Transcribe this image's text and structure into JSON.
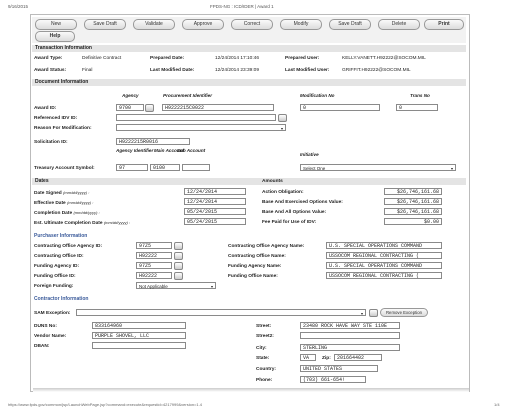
{
  "header": {
    "date": "9/16/2015",
    "title": "FPDS-NG : ICD/IDER | Award 1"
  },
  "toolbar": {
    "buttons": [
      "New",
      "Save Draft",
      "Validate",
      "Approve",
      "Correct",
      "Modify",
      "Save Draft",
      "Delete",
      "Print",
      "Help"
    ]
  },
  "transaction": {
    "section": "Transaction Information",
    "award_type_label": "Award Type:",
    "award_type": "Definitive Contract",
    "prepared_date_label": "Prepared Date:",
    "prepared_date": "12/24/2014 17:10:46",
    "prepared_user_label": "Prepared User:",
    "prepared_user": "KELLY.VANETT.H92222@SOCOM.MIL",
    "award_status_label": "Award Status:",
    "award_status": "Final",
    "last_modified_date_label": "Last Modified Date:",
    "last_modified_date": "12/24/2014 23:39:09",
    "last_modified_user_label": "Last Modified User:",
    "last_modified_user": "GRIFFIT.H92222@SOCOM.MIL"
  },
  "document": {
    "section": "Document Information",
    "col_agency": "Agency",
    "col_proc": "Procurement Identifier",
    "col_mod": "Modification No",
    "col_trans": "Trans No",
    "award_id_label": "Award ID:",
    "agency_code": "9700",
    "proc_id": "H9222215C0022",
    "mod_no": "0",
    "trans_no": "0",
    "ref_idv_label": "Referenced IDV ID:",
    "reason_label": "Reason For Modification:",
    "solicitation_label": "Solicitation ID:",
    "solicitation_id": "H9222215R0016",
    "col_agency_id": "Agency Identifier",
    "col_main": "Main Account",
    "col_sub": "Sub Account",
    "col_initiative": "Initiative",
    "tas_label": "Treasury Account Symbol:",
    "tas_agency": "97",
    "tas_main": "0100",
    "initiative": "Select One"
  },
  "dates": {
    "section": "Dates",
    "signed_label": "Date Signed",
    "signed_fmt": "(mm/dd/yyyy) :",
    "signed": "12/24/2014",
    "effective_label": "Effective Date",
    "effective_fmt": "(mm/dd/yyyy) :",
    "effective": "12/24/2014",
    "completion_label": "Completion Date",
    "completion_fmt": "(mm/dd/yyyy) :",
    "completion": "05/24/2015",
    "est_label": "Est. Ultimate Completion Date",
    "est_fmt": "(mm/dd/yyyy) :",
    "est": "05/24/2015"
  },
  "amounts": {
    "section": "Amounts",
    "obligation_label": "Action Obligation:",
    "obligation": "$26,746,161.68",
    "exercised_label": "Base And Exercised Options Value:",
    "exercised": "$26,746,161.68",
    "all_options_label": "Base And All Options Value:",
    "all_options": "$26,746,161.68",
    "fee_label": "Fee Paid for Use of IDV:",
    "fee": "$0.00"
  },
  "purchaser": {
    "section": "Purchaser Information",
    "co_agency_id_label": "Contracting Office Agency ID:",
    "co_agency_id": "97Z5",
    "co_agency_name_label": "Contracting Office Agency Name:",
    "co_agency_name": "U.S. SPECIAL OPERATIONS COMMAND",
    "co_id_label": "Contracting Office ID:",
    "co_id": "H92222",
    "co_name_label": "Contracting Office Name:",
    "co_name": "USSOCOM REGIONAL CONTRACTING (",
    "f_agency_id_label": "Funding Agency ID:",
    "f_agency_id": "97Z5",
    "f_agency_name_label": "Funding Agency Name:",
    "f_agency_name": "U.S. SPECIAL OPERATIONS COMMAND",
    "f_office_id_label": "Funding Office ID:",
    "f_office_id": "H92222",
    "f_office_name_label": "Funding Office Name:",
    "f_office_name": "USSOCOM REGIONAL CONTRACTING (",
    "foreign_label": "Foreign Funding:",
    "foreign": "Not Applicable"
  },
  "contractor": {
    "section": "Contractor Information",
    "sam_label": "SAM Exception:",
    "remove_exception": "Remove Exception",
    "duns_label": "DUNS No:",
    "duns": "833164960",
    "vendor_label": "Vendor Name:",
    "vendor": "PURPLE SHOVEL, LLC",
    "dban_label": "DBAN:",
    "street_label": "Street:",
    "street": "23480 ROCK HAVE WAY STE 110E",
    "street2_label": "Street2:",
    "city_label": "City:",
    "city": "STERLING",
    "state_label": "State:",
    "state": "VA",
    "zip_label": "Zip:",
    "zip": "201664402",
    "country_label": "Country:",
    "country": "UNITED STATES",
    "phone_label": "Phone:",
    "phone": "(703) 661-654!"
  },
  "footer": {
    "url": "https://www.fpds.gov/common/jsp/LaunchWebPage.jsp?command=execute&requestid=4217999&version=1.4",
    "page": "1/4"
  }
}
